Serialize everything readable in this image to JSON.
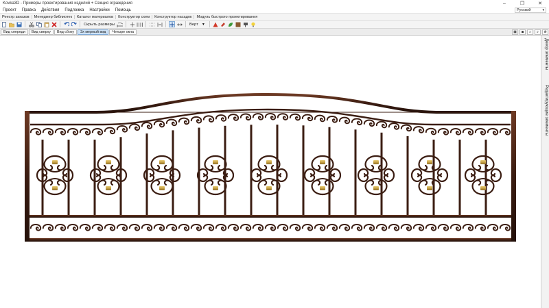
{
  "window": {
    "title": "Kovka3D - Примеры проектирования изделий + Секция ограждения",
    "minimize_icon": "minimize-icon",
    "maximize_icon": "maximize-icon",
    "close_icon": "close-icon"
  },
  "menu": {
    "items": [
      "Проект",
      "Правка",
      "Действия",
      "Подложка",
      "Настройки",
      "Помощь"
    ],
    "language": "Русский"
  },
  "extensions": {
    "items": [
      "Реестр заказов",
      "Менеджер библиотек",
      "Каталог материалов",
      "Конструктор схем",
      "Конструктор насадок",
      "Модуль быстрого проектирования"
    ]
  },
  "toolbar": {
    "hide_sizes_label": "Скрыть размеры",
    "vert_label": "Верт"
  },
  "views": {
    "tabs": [
      "Вид спереди",
      "Вид сверху",
      "Вид сбоку",
      "3х мерный вид",
      "Четыре окна"
    ],
    "active_index": 3
  },
  "right_panel": {
    "tabs": [
      "Декор элементы",
      "Редактирующие элементы"
    ]
  },
  "colors": {
    "metal": "#3b1d12",
    "metal_highlight": "#6e3a24",
    "brass": "#c9a347",
    "toolbar_bg": "#f4f4f4"
  }
}
